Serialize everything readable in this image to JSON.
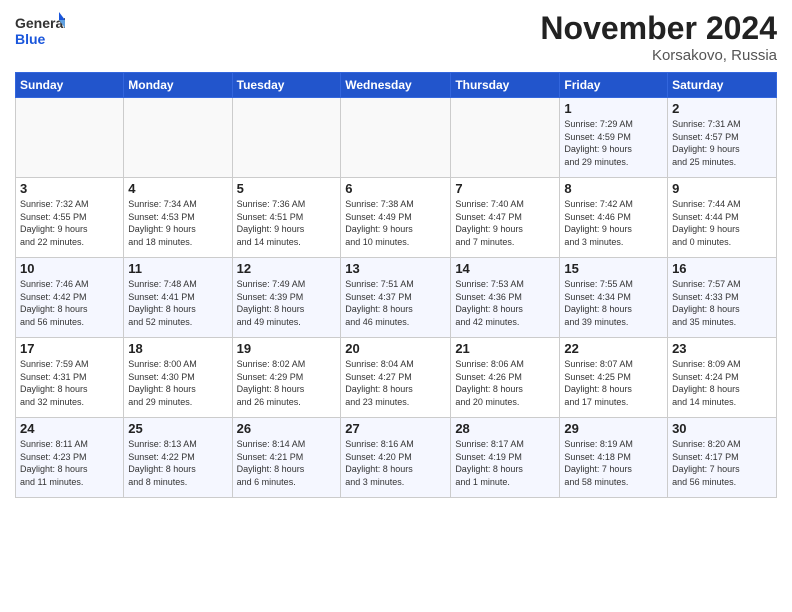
{
  "header": {
    "logo_general": "General",
    "logo_blue": "Blue",
    "month_title": "November 2024",
    "location": "Korsakovo, Russia"
  },
  "weekdays": [
    "Sunday",
    "Monday",
    "Tuesday",
    "Wednesday",
    "Thursday",
    "Friday",
    "Saturday"
  ],
  "weeks": [
    [
      {
        "day": "",
        "info": ""
      },
      {
        "day": "",
        "info": ""
      },
      {
        "day": "",
        "info": ""
      },
      {
        "day": "",
        "info": ""
      },
      {
        "day": "",
        "info": ""
      },
      {
        "day": "1",
        "info": "Sunrise: 7:29 AM\nSunset: 4:59 PM\nDaylight: 9 hours\nand 29 minutes."
      },
      {
        "day": "2",
        "info": "Sunrise: 7:31 AM\nSunset: 4:57 PM\nDaylight: 9 hours\nand 25 minutes."
      }
    ],
    [
      {
        "day": "3",
        "info": "Sunrise: 7:32 AM\nSunset: 4:55 PM\nDaylight: 9 hours\nand 22 minutes."
      },
      {
        "day": "4",
        "info": "Sunrise: 7:34 AM\nSunset: 4:53 PM\nDaylight: 9 hours\nand 18 minutes."
      },
      {
        "day": "5",
        "info": "Sunrise: 7:36 AM\nSunset: 4:51 PM\nDaylight: 9 hours\nand 14 minutes."
      },
      {
        "day": "6",
        "info": "Sunrise: 7:38 AM\nSunset: 4:49 PM\nDaylight: 9 hours\nand 10 minutes."
      },
      {
        "day": "7",
        "info": "Sunrise: 7:40 AM\nSunset: 4:47 PM\nDaylight: 9 hours\nand 7 minutes."
      },
      {
        "day": "8",
        "info": "Sunrise: 7:42 AM\nSunset: 4:46 PM\nDaylight: 9 hours\nand 3 minutes."
      },
      {
        "day": "9",
        "info": "Sunrise: 7:44 AM\nSunset: 4:44 PM\nDaylight: 9 hours\nand 0 minutes."
      }
    ],
    [
      {
        "day": "10",
        "info": "Sunrise: 7:46 AM\nSunset: 4:42 PM\nDaylight: 8 hours\nand 56 minutes."
      },
      {
        "day": "11",
        "info": "Sunrise: 7:48 AM\nSunset: 4:41 PM\nDaylight: 8 hours\nand 52 minutes."
      },
      {
        "day": "12",
        "info": "Sunrise: 7:49 AM\nSunset: 4:39 PM\nDaylight: 8 hours\nand 49 minutes."
      },
      {
        "day": "13",
        "info": "Sunrise: 7:51 AM\nSunset: 4:37 PM\nDaylight: 8 hours\nand 46 minutes."
      },
      {
        "day": "14",
        "info": "Sunrise: 7:53 AM\nSunset: 4:36 PM\nDaylight: 8 hours\nand 42 minutes."
      },
      {
        "day": "15",
        "info": "Sunrise: 7:55 AM\nSunset: 4:34 PM\nDaylight: 8 hours\nand 39 minutes."
      },
      {
        "day": "16",
        "info": "Sunrise: 7:57 AM\nSunset: 4:33 PM\nDaylight: 8 hours\nand 35 minutes."
      }
    ],
    [
      {
        "day": "17",
        "info": "Sunrise: 7:59 AM\nSunset: 4:31 PM\nDaylight: 8 hours\nand 32 minutes."
      },
      {
        "day": "18",
        "info": "Sunrise: 8:00 AM\nSunset: 4:30 PM\nDaylight: 8 hours\nand 29 minutes."
      },
      {
        "day": "19",
        "info": "Sunrise: 8:02 AM\nSunset: 4:29 PM\nDaylight: 8 hours\nand 26 minutes."
      },
      {
        "day": "20",
        "info": "Sunrise: 8:04 AM\nSunset: 4:27 PM\nDaylight: 8 hours\nand 23 minutes."
      },
      {
        "day": "21",
        "info": "Sunrise: 8:06 AM\nSunset: 4:26 PM\nDaylight: 8 hours\nand 20 minutes."
      },
      {
        "day": "22",
        "info": "Sunrise: 8:07 AM\nSunset: 4:25 PM\nDaylight: 8 hours\nand 17 minutes."
      },
      {
        "day": "23",
        "info": "Sunrise: 8:09 AM\nSunset: 4:24 PM\nDaylight: 8 hours\nand 14 minutes."
      }
    ],
    [
      {
        "day": "24",
        "info": "Sunrise: 8:11 AM\nSunset: 4:23 PM\nDaylight: 8 hours\nand 11 minutes."
      },
      {
        "day": "25",
        "info": "Sunrise: 8:13 AM\nSunset: 4:22 PM\nDaylight: 8 hours\nand 8 minutes."
      },
      {
        "day": "26",
        "info": "Sunrise: 8:14 AM\nSunset: 4:21 PM\nDaylight: 8 hours\nand 6 minutes."
      },
      {
        "day": "27",
        "info": "Sunrise: 8:16 AM\nSunset: 4:20 PM\nDaylight: 8 hours\nand 3 minutes."
      },
      {
        "day": "28",
        "info": "Sunrise: 8:17 AM\nSunset: 4:19 PM\nDaylight: 8 hours\nand 1 minute."
      },
      {
        "day": "29",
        "info": "Sunrise: 8:19 AM\nSunset: 4:18 PM\nDaylight: 7 hours\nand 58 minutes."
      },
      {
        "day": "30",
        "info": "Sunrise: 8:20 AM\nSunset: 4:17 PM\nDaylight: 7 hours\nand 56 minutes."
      }
    ]
  ]
}
